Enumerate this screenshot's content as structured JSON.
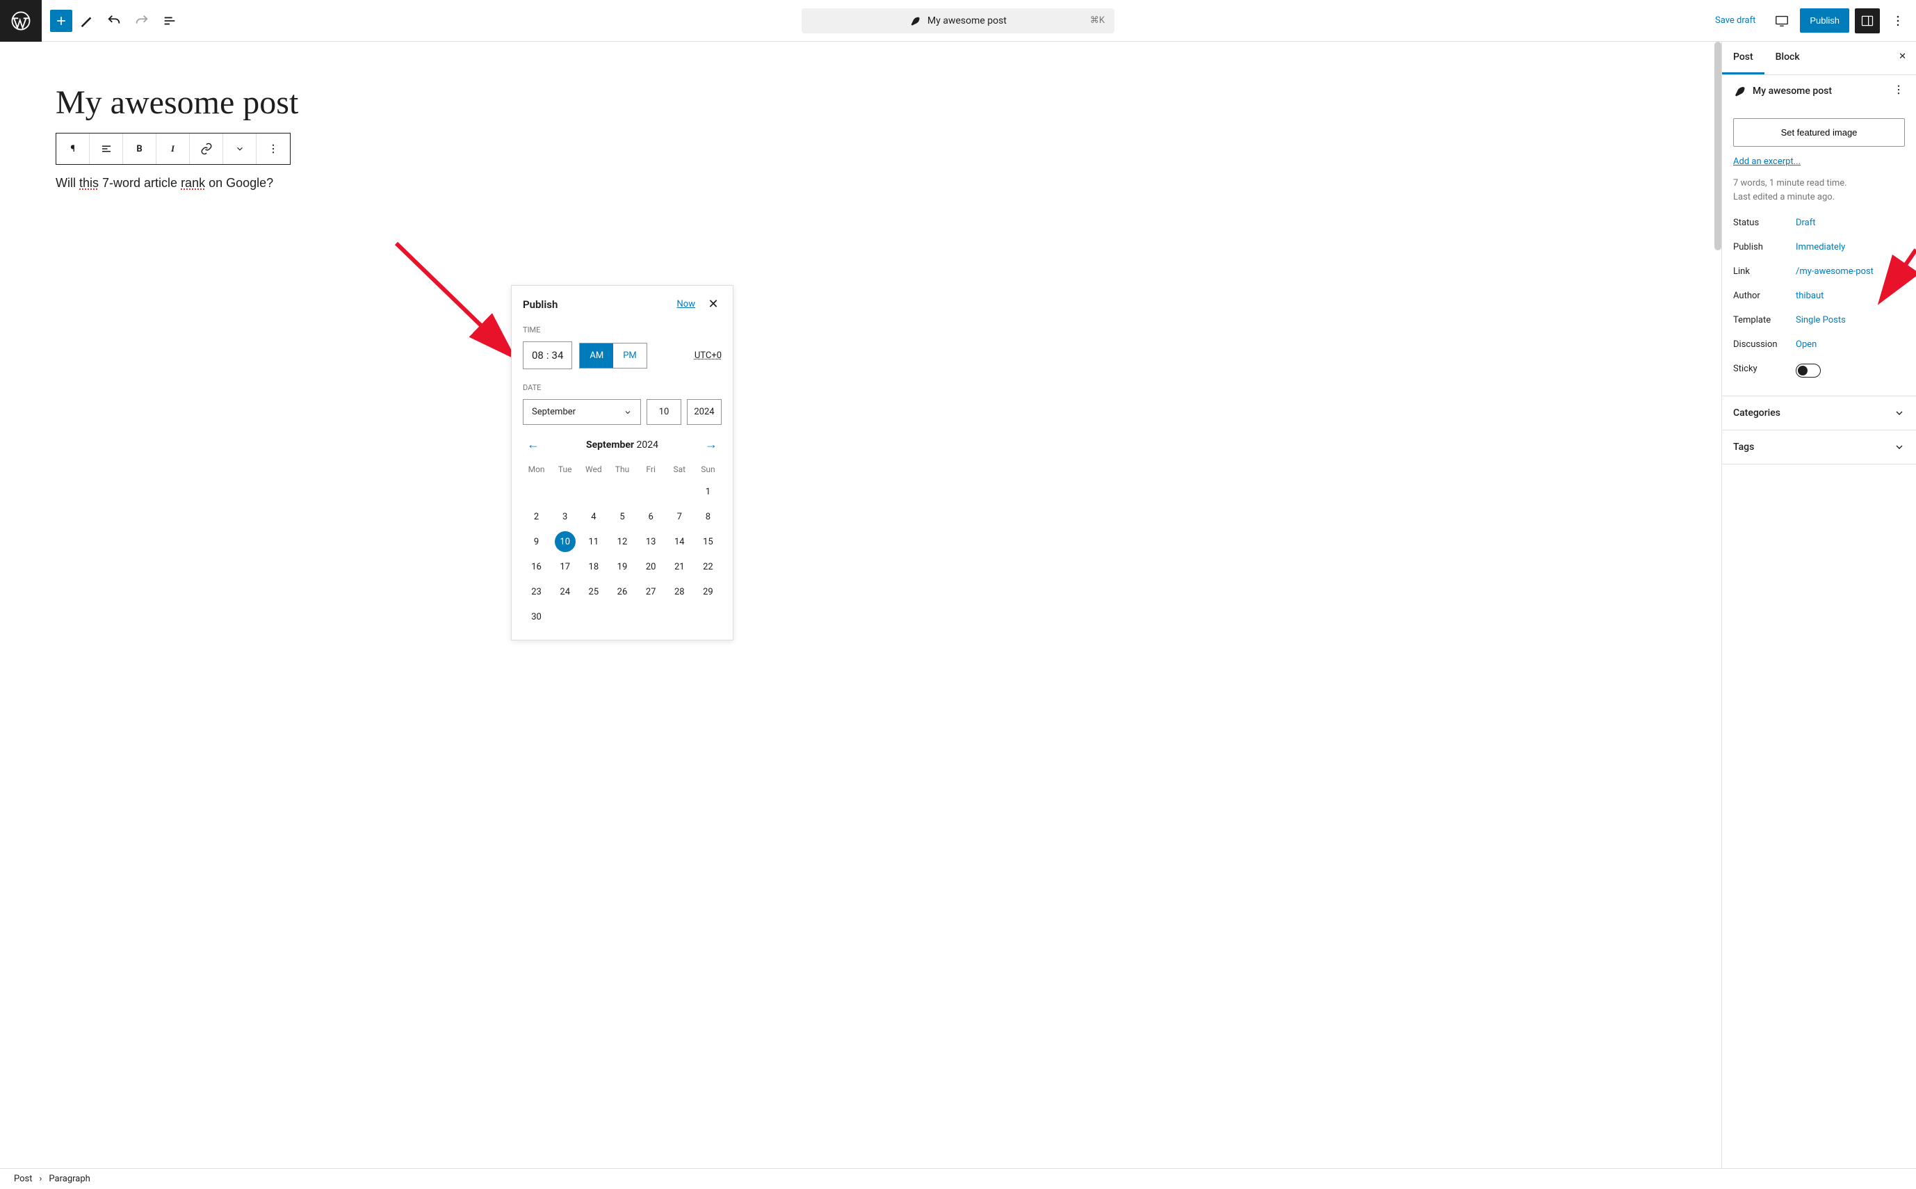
{
  "topbar": {
    "title": "My awesome post",
    "shortcut": "⌘K",
    "save_draft": "Save draft",
    "publish": "Publish"
  },
  "editor": {
    "post_title": "My awesome post",
    "paragraph_pre": "Will ",
    "paragraph_u1": "this",
    "paragraph_mid": " 7-word article ",
    "paragraph_u2": "rank",
    "paragraph_post": " on Google?",
    "block_toolbar": {
      "para": "¶",
      "bold": "B",
      "italic": "I"
    }
  },
  "popup": {
    "title": "Publish",
    "now": "Now",
    "time_label": "TIME",
    "hour": "08",
    "minute": "34",
    "am": "AM",
    "pm": "PM",
    "utc": "UTC+0",
    "date_label": "DATE",
    "month_select": "September",
    "day_input": "10",
    "year_input": "2024",
    "cal_month": "September",
    "cal_year": "2024",
    "dow": [
      "Mon",
      "Tue",
      "Wed",
      "Thu",
      "Fri",
      "Sat",
      "Sun"
    ],
    "days_leading_empty": 6,
    "days": [
      "1",
      "2",
      "3",
      "4",
      "5",
      "6",
      "7",
      "8",
      "9",
      "10",
      "11",
      "12",
      "13",
      "14",
      "15",
      "16",
      "17",
      "18",
      "19",
      "20",
      "21",
      "22",
      "23",
      "24",
      "25",
      "26",
      "27",
      "28",
      "29",
      "30"
    ],
    "selected_day": "10"
  },
  "sidebar": {
    "tabs": {
      "post": "Post",
      "block": "Block"
    },
    "post_title": "My awesome post",
    "featured_image": "Set featured image",
    "excerpt_link": "Add an excerpt...",
    "meta_text_1": "7 words, 1 minute read time.",
    "meta_text_2": "Last edited a minute ago.",
    "rows": {
      "status_label": "Status",
      "status_value": "Draft",
      "publish_label": "Publish",
      "publish_value": "Immediately",
      "link_label": "Link",
      "link_value": "/my-awesome-post",
      "author_label": "Author",
      "author_value": "thibaut",
      "template_label": "Template",
      "template_value": "Single Posts",
      "discussion_label": "Discussion",
      "discussion_value": "Open",
      "sticky_label": "Sticky"
    },
    "categories": "Categories",
    "tags": "Tags"
  },
  "footer": {
    "crumb1": "Post",
    "crumb2": "Paragraph"
  }
}
